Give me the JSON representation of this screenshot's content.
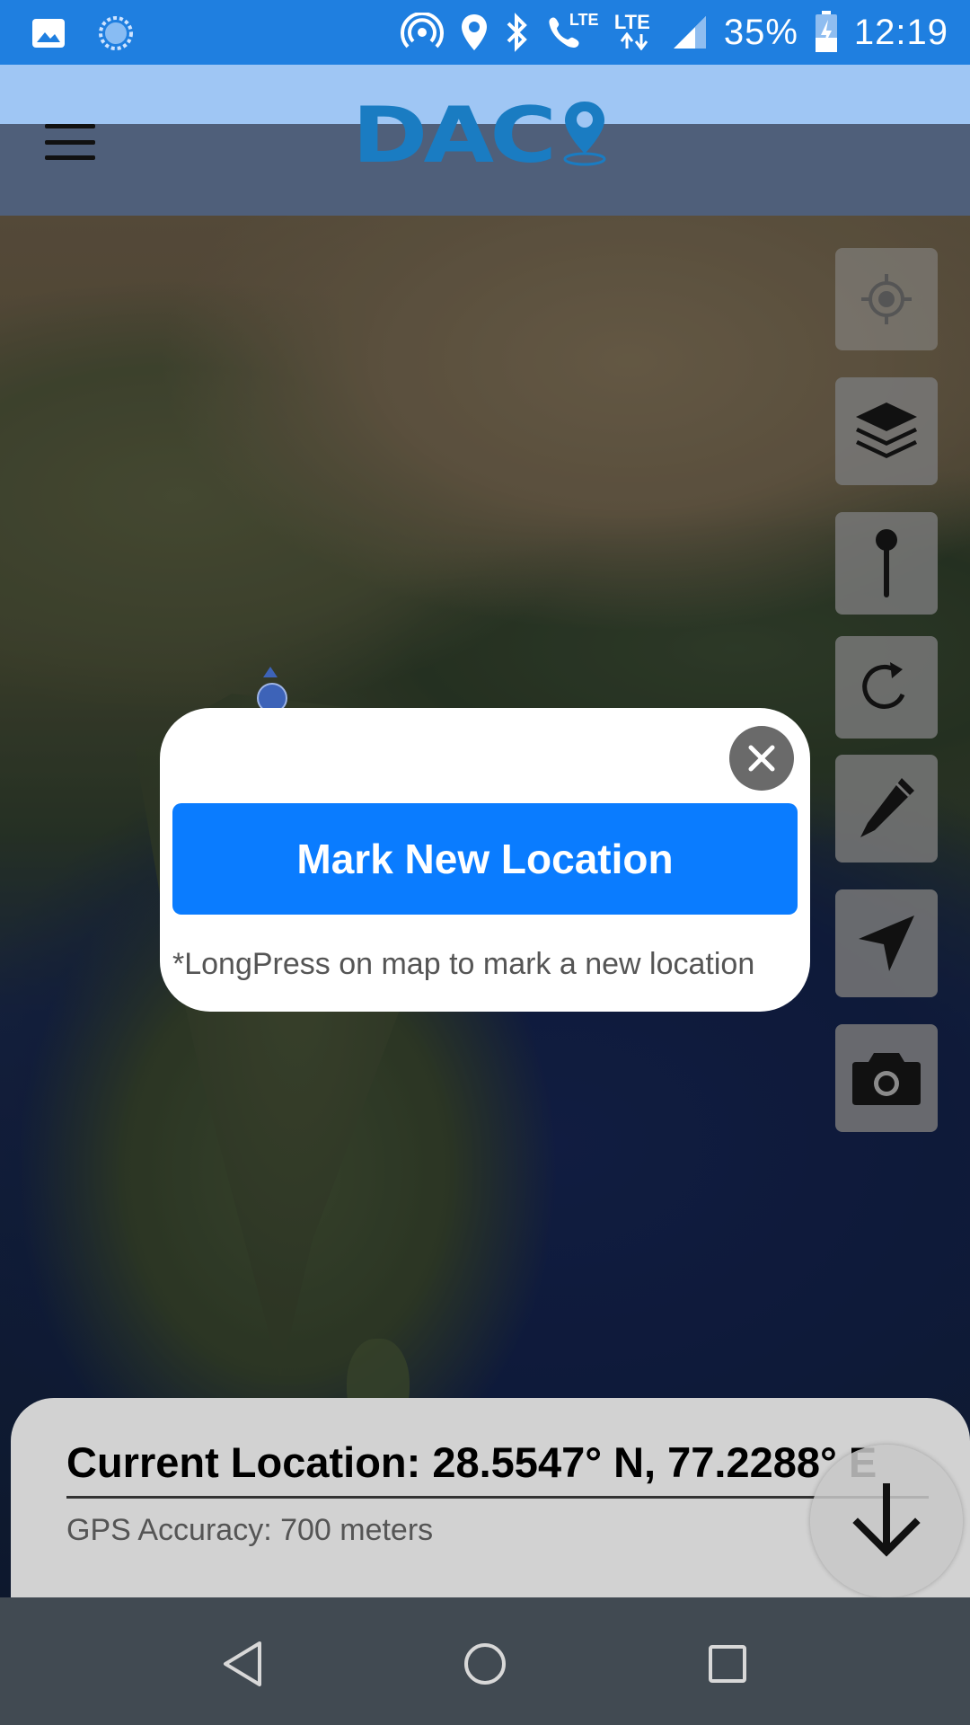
{
  "status_bar": {
    "battery": "35%",
    "time": "12:19",
    "lte1": "LTE",
    "lte2": "LTE",
    "icons_left": [
      "image-icon",
      "sync-icon"
    ],
    "icons_right": [
      "hotspot-icon",
      "location-icon",
      "bluetooth-icon",
      "volte-call-icon",
      "lte-signal-icon",
      "signal-icon",
      "battery-charging-icon"
    ]
  },
  "header": {
    "logo_text": "DAC",
    "logo_icon": "map-pin-icon",
    "menu_icon": "hamburger-menu-icon"
  },
  "tools": [
    {
      "name": "my-location",
      "icon": "crosshair-icon"
    },
    {
      "name": "layers",
      "icon": "layers-icon"
    },
    {
      "name": "pin",
      "icon": "pin-icon"
    },
    {
      "name": "refresh",
      "icon": "refresh-icon"
    },
    {
      "name": "draw",
      "icon": "pencil-icon"
    },
    {
      "name": "navigate",
      "icon": "navigation-arrow-icon"
    },
    {
      "name": "camera",
      "icon": "camera-icon"
    }
  ],
  "modal": {
    "button_label": "Mark New Location",
    "hint": "*LongPress on map to mark a new location",
    "close_icon": "close-icon"
  },
  "location_panel": {
    "current_location": "Current Location: 28.5547° N, 77.2288° E",
    "gps_accuracy": "GPS Accuracy: 700 meters",
    "collapse_icon": "arrow-down-icon"
  },
  "colors": {
    "status_bar": "#1f7fe0",
    "header_light": "#9fc6f4",
    "header_dark": "#4f5f7a",
    "logo": "#1a7cc2",
    "primary_button": "#0a7cff",
    "nav_bar": "#414a52"
  }
}
